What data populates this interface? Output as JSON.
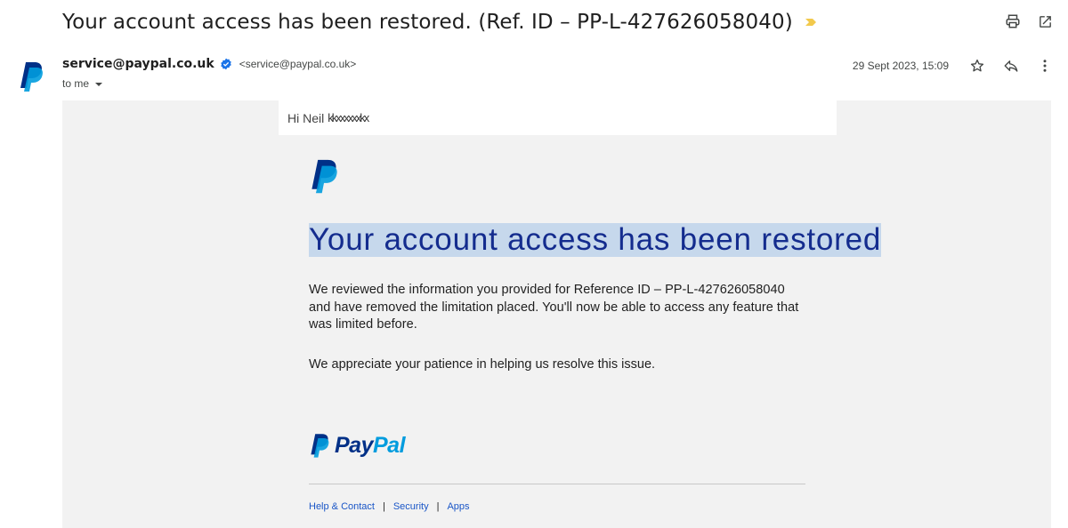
{
  "email": {
    "subject": "Your account access has been restored. (Ref. ID – PP-L-427626058040)",
    "importance_icon": "importance-marker-icon",
    "sender": {
      "name": "service@paypal.co.uk",
      "email_display": "<service@paypal.co.uk>",
      "verified_icon": "verified-badge-icon",
      "avatar_icon": "paypal-p-icon"
    },
    "recipient_label": "to me",
    "date": "29 Sept 2023, 15:09",
    "toolbar": {
      "print_icon": "print-icon",
      "popout_icon": "open-in-new-window-icon",
      "star_icon": "star-icon",
      "reply_icon": "reply-icon",
      "more_icon": "more-vert-icon"
    }
  },
  "body": {
    "greeting": "Hi Neil",
    "greeting_redacted": "kkxxxxxxkx",
    "headline": "Your account access has been restored",
    "paragraph1": "We reviewed the information you provided for Reference ID – PP-L-427626058040 and have removed the limitation placed. You'll now be able to access any feature that was limited before.",
    "paragraph2": "We appreciate your patience in helping us resolve this issue.",
    "logo_wordmark_part1": "Pay",
    "logo_wordmark_part2": "Pal",
    "footer_links": [
      "Help & Contact",
      "Security",
      "Apps"
    ],
    "footer_separator": "|"
  },
  "colors": {
    "paypal_dark_blue": "#003087",
    "paypal_light_blue": "#009cde",
    "headline_blue": "#142c8e",
    "highlight": "#c6d8ec",
    "link_blue": "#1a56c7",
    "canvas_grey": "#f2f2f2",
    "importance_yellow": "#f2c94c"
  }
}
